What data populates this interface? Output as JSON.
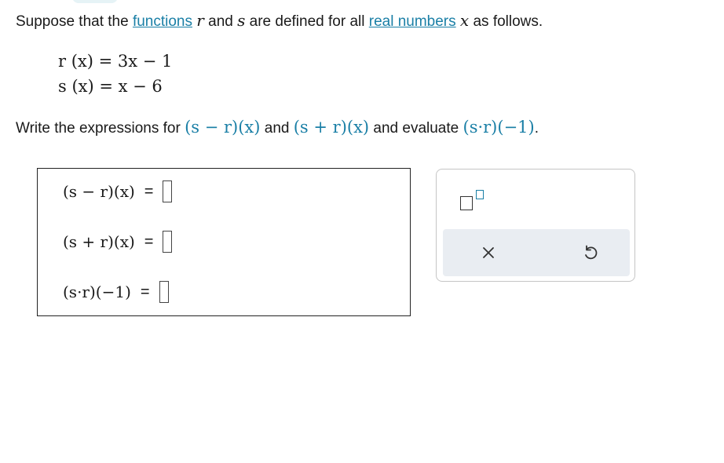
{
  "intro": {
    "before": "Suppose that the ",
    "link_functions": "functions",
    "var_r": "r",
    "and": " and ",
    "var_s": "s",
    "middle": " are defined for all ",
    "link_real_numbers": "real numbers",
    "var_x": "x",
    "after": " as follows."
  },
  "definitions": [
    "r (x) = 3x − 1",
    "s (x) = x − 6"
  ],
  "instruction": {
    "before": "Write the expressions for ",
    "expr1": "(s − r)(x)",
    "and": " and ",
    "expr2": "(s + r)(x)",
    "middle": " and evaluate ",
    "expr3": "(s·r)(−1)",
    "after": "."
  },
  "answers": [
    {
      "label": "(s − r)(x)",
      "equals": "=",
      "value": ""
    },
    {
      "label": "(s + r)(x)",
      "equals": "=",
      "value": ""
    },
    {
      "label": "(s·r)(−1)",
      "equals": "=",
      "value": ""
    }
  ],
  "toolbox": {
    "exponent_tool": "exponent-template",
    "clear_icon": "×",
    "undo_icon": "↺"
  },
  "colors": {
    "link": "#1a7fa6",
    "toolbar_bg": "#e9edf2"
  }
}
